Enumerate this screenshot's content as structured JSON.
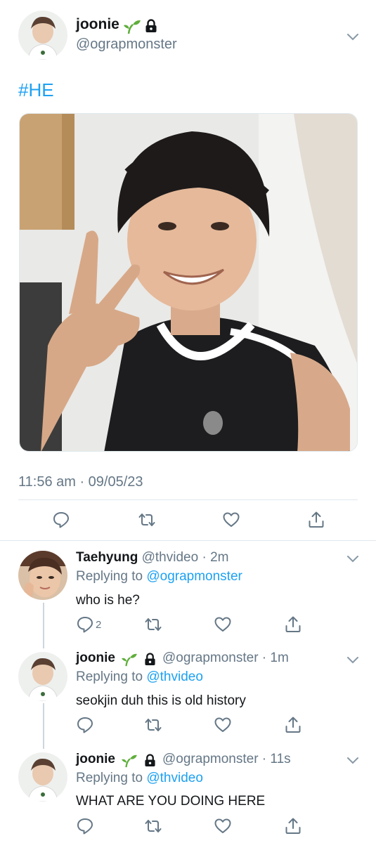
{
  "tweet": {
    "display_name": "joonie",
    "handle": "@ograpmonster",
    "text": "#HE",
    "timestamp": "11:56 am · 09/05/23",
    "image_description": ""
  },
  "replies": [
    {
      "display_name": "Taehyung",
      "handle": "@thvideo",
      "time": "2m",
      "replying_label": "Replying to",
      "replying_to": "@ograpmonster",
      "text": "who is he?",
      "reply_count": "2"
    },
    {
      "display_name": "joonie",
      "handle": "@ograpmonster",
      "time": "1m",
      "replying_label": "Replying to",
      "replying_to": "@thvideo",
      "text": "seokjin duh this is old history",
      "reply_count": ""
    },
    {
      "display_name": "joonie",
      "handle": "@ograpmonster",
      "time": "11s",
      "replying_label": "Replying to",
      "replying_to": "@thvideo",
      "text": "WHAT ARE YOU DOING HERE",
      "reply_count": ""
    }
  ],
  "separator": " · ",
  "colors": {
    "accent": "#1da1f2",
    "muted": "#657786",
    "text": "#14171a",
    "sprout": "#5fae3b"
  },
  "icons": [
    "sprout-icon",
    "lock-icon",
    "chevron-down-icon",
    "reply-icon",
    "retweet-icon",
    "like-icon",
    "share-icon"
  ]
}
